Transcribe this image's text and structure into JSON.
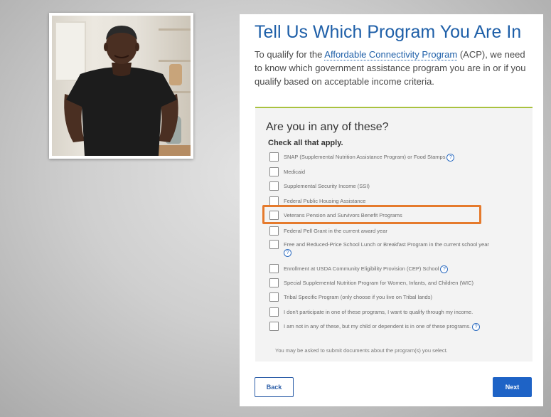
{
  "page": {
    "title": "Tell Us Which Program You Are In",
    "intro_before": "To qualify for the ",
    "intro_link": "Affordable Connectivity Program",
    "intro_after": " (ACP), we need to know which government assistance program you are in or if you qualify based on acceptable income criteria."
  },
  "panel": {
    "heading": "Are you in any of these?",
    "subheading": "Check all that apply.",
    "options": [
      {
        "label": "SNAP (Supplemental Nutrition Assistance Program) or Food Stamps",
        "info_icon": true
      },
      {
        "label": "Medicaid",
        "info_icon": false
      },
      {
        "label": "Supplemental Security Income (SSI)",
        "info_icon": false
      },
      {
        "label": "Federal Public Housing Assistance",
        "info_icon": false
      },
      {
        "label": "Veterans Pension and Survivors Benefit Programs",
        "info_icon": false,
        "highlighted": true
      },
      {
        "label": "Federal Pell Grant in the current award year",
        "info_icon": false
      },
      {
        "label": "Free and Reduced-Price School Lunch or Breakfast Program in the current school year",
        "info_icon": true
      },
      {
        "label": "Enrollment at USDA Community Eligibility Provision (CEP) School",
        "info_icon": true
      },
      {
        "label": "Special Supplemental Nutrition Program for Women, Infants, and Children (WIC)",
        "info_icon": false
      },
      {
        "label": "Tribal Specific Program (only choose if you live on Tribal lands)",
        "info_icon": false
      },
      {
        "label": "I don't participate in one of these programs, I want to qualify through my income.",
        "info_icon": false
      },
      {
        "label": "I am not in any of these, but my child or dependent is in one of these programs.",
        "info_icon": true
      }
    ],
    "note": "You may be asked to submit documents about the program(s) you select."
  },
  "buttons": {
    "back": "Back",
    "next": "Next"
  },
  "icons": {
    "info": "info-icon",
    "checkbox": "checkbox-icon"
  },
  "colors": {
    "title": "#1e5fa8",
    "accent_line": "#a9c23f",
    "highlight": "#e57a2c",
    "primary_button": "#1e63c6"
  }
}
